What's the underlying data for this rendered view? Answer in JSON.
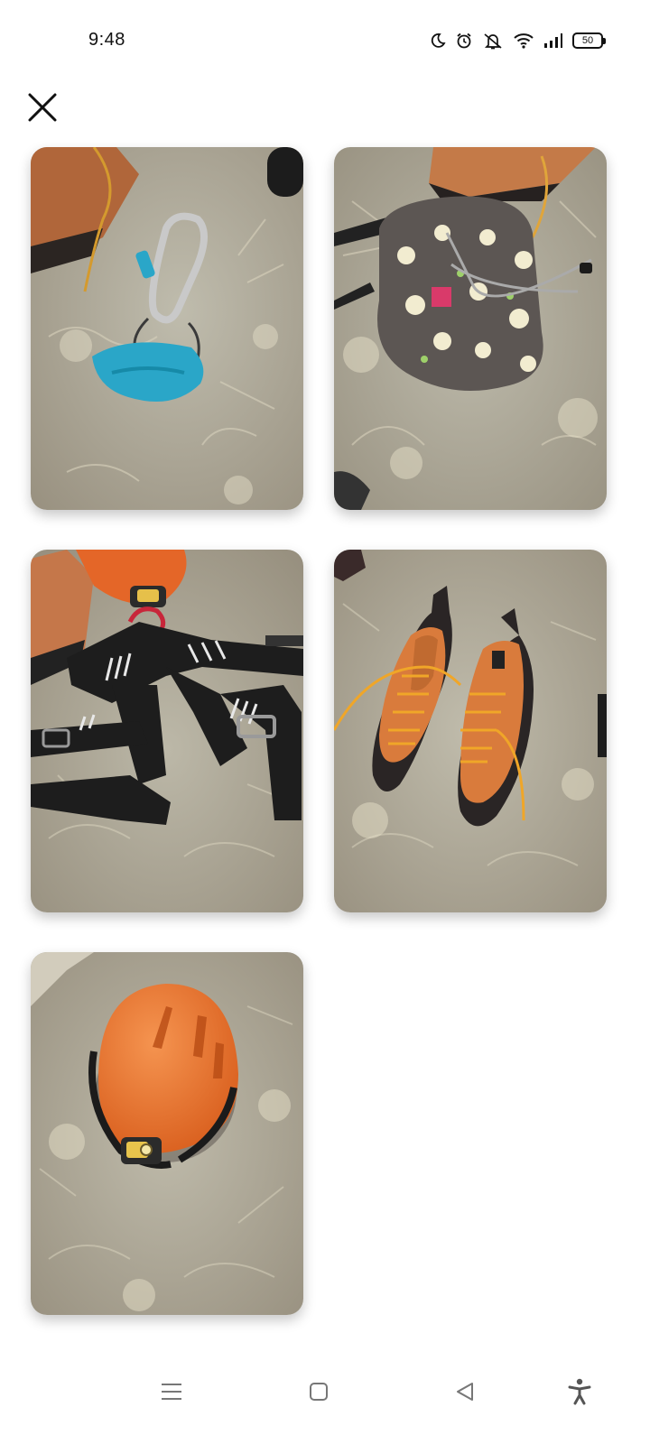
{
  "status_bar": {
    "time": "9:48",
    "battery": "50",
    "icons": [
      "moon-icon",
      "alarm-icon",
      "mute-icon",
      "wifi-icon",
      "signal-icon",
      "battery-icon"
    ]
  },
  "toolbar": {
    "close_icon": "close-icon"
  },
  "photos": [
    {
      "subject": "carabiner-belay-device"
    },
    {
      "subject": "chalk-bag"
    },
    {
      "subject": "climbing-harness"
    },
    {
      "subject": "climbing-shoes"
    },
    {
      "subject": "helmet-headlamp"
    }
  ],
  "nav_bar": {
    "icons": [
      "menu-icon",
      "home-icon",
      "back-icon",
      "accessibility-icon"
    ]
  },
  "colors": {
    "background": "#ffffff",
    "blanket": "#b3b0a0",
    "orange": "#e66b2a",
    "blue": "#2aa6c8",
    "dark": "#1e1e1e"
  }
}
